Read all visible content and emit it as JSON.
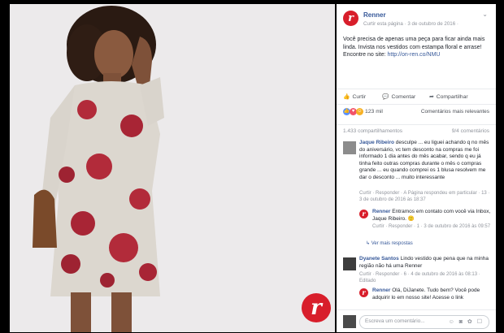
{
  "brand": {
    "logo_letter": "r",
    "accent": "#d81e2b"
  },
  "post": {
    "page_name": "Renner",
    "meta_text": "Curtir esta página · 3 de outubro de 2016 ·",
    "text_before_link": "Você precisa de apenas uma peça para ficar ainda mais linda. Invista nos vestidos com estampa floral e arrase! Encontre no site: ",
    "link": "http://on-ren.co/NMU",
    "actions": {
      "like": "Curtir",
      "comment": "Comentar",
      "share": "Compartilhar"
    },
    "reactions_count": "123 mil",
    "relevance": "Comentários mais relevantes",
    "shares": "1.433 compartilhamentos",
    "comments_count": "9/4 comentários"
  },
  "comments": [
    {
      "author": "Jaque Ribeiro",
      "text": "desculpe ... eu liguei achando q no mês do aniversário, vc tem desconto na compras me foi informado 1 dia antes do mês acabar, sendo q eu já tinha feito outras compras durante o mês o compras grande ... eu quando comprei os 1 blusa resolvem me dar o desconto ... muito interessante",
      "sub": "Curtir · Responder · A Página respondeu em particular · 13 · 3 de outubro de 2016 às 18:37"
    },
    {
      "author": "Renner",
      "text": "Entramos em contato com você via Inbox, Jaque Ribeiro. 🙂",
      "sub": "Curtir · Responder · 1 · 3 de outubro de 2016 às 09:57"
    },
    {
      "more": "Ver mais respostas"
    },
    {
      "author": "Dyanete Santos",
      "text": "Lindo vestido que pena que na minha região não há uma Renner",
      "sub": "Curtir · Responder · 6 · 4 de outubro de 2016 às 08:13 · Editado"
    },
    {
      "author": "Renner",
      "text": "Olá, DiJanete. Tudo bem? Você pode adquirir lo em nosso site! Acesse o link",
      "sub": ""
    }
  ],
  "composer": {
    "placeholder": "Escreva um comentário...",
    "tools": "☺ ◙ ✿ ☐"
  }
}
